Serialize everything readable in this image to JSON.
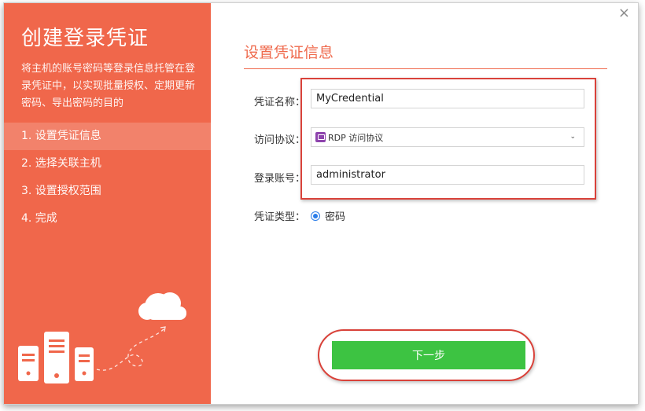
{
  "sidebar": {
    "title": "创建登录凭证",
    "description": "将主机的账号密码等登录信息托管在登录凭证中，以实现批量授权、定期更新密码、导出密码的目的",
    "steps": [
      {
        "label": "1. 设置凭证信息",
        "active": true
      },
      {
        "label": "2. 选择关联主机",
        "active": false
      },
      {
        "label": "3. 设置授权范围",
        "active": false
      },
      {
        "label": "4. 完成",
        "active": false
      }
    ]
  },
  "main": {
    "title": "设置凭证信息",
    "close_glyph": "×",
    "fields": {
      "credential_name": {
        "label": "凭证名称：",
        "value": "MyCredential"
      },
      "protocol": {
        "label": "访问协议：",
        "value": "RDP 访问协议",
        "icon": "rdp-icon"
      },
      "login_account": {
        "label": "登录账号：",
        "value": "administrator"
      },
      "credential_type": {
        "label": "凭证类型：",
        "option": "密码",
        "selected": true
      }
    },
    "next_button": "下一步"
  },
  "colors": {
    "sidebar_bg": "#f0674b",
    "accent": "#ef6a4d",
    "primary_button": "#3dc342",
    "highlight": "#d9423a",
    "radio": "#2b7de9"
  }
}
